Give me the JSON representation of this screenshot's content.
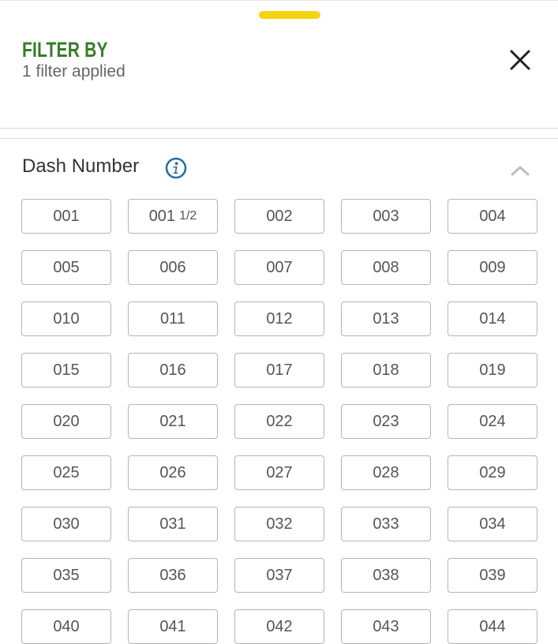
{
  "header": {
    "title": "FILTER BY",
    "subtitle": "1 filter applied",
    "close_icon": "close-icon"
  },
  "colors": {
    "accent_green": "#367c2b",
    "handle_yellow": "#f5d40f",
    "info_blue": "#1f6e9c"
  },
  "section": {
    "title": "Dash Number",
    "info_icon": "info-icon",
    "collapse_icon": "chevron-up-icon",
    "chips": [
      {
        "label": "001"
      },
      {
        "label": "001",
        "fraction": "1/2"
      },
      {
        "label": "002"
      },
      {
        "label": "003"
      },
      {
        "label": "004"
      },
      {
        "label": "005"
      },
      {
        "label": "006"
      },
      {
        "label": "007"
      },
      {
        "label": "008"
      },
      {
        "label": "009"
      },
      {
        "label": "010"
      },
      {
        "label": "011"
      },
      {
        "label": "012"
      },
      {
        "label": "013"
      },
      {
        "label": "014"
      },
      {
        "label": "015"
      },
      {
        "label": "016"
      },
      {
        "label": "017"
      },
      {
        "label": "018"
      },
      {
        "label": "019"
      },
      {
        "label": "020"
      },
      {
        "label": "021"
      },
      {
        "label": "022"
      },
      {
        "label": "023"
      },
      {
        "label": "024"
      },
      {
        "label": "025"
      },
      {
        "label": "026"
      },
      {
        "label": "027"
      },
      {
        "label": "028"
      },
      {
        "label": "029"
      },
      {
        "label": "030"
      },
      {
        "label": "031"
      },
      {
        "label": "032"
      },
      {
        "label": "033"
      },
      {
        "label": "034"
      },
      {
        "label": "035"
      },
      {
        "label": "036"
      },
      {
        "label": "037"
      },
      {
        "label": "038"
      },
      {
        "label": "039"
      },
      {
        "label": "040"
      },
      {
        "label": "041"
      },
      {
        "label": "042"
      },
      {
        "label": "043"
      },
      {
        "label": "044"
      }
    ]
  }
}
